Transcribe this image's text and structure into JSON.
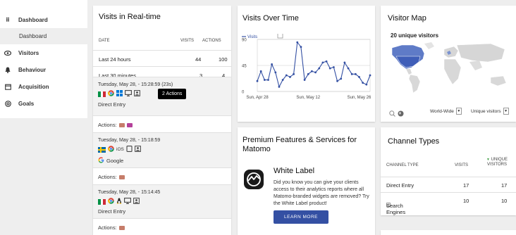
{
  "sidebar": {
    "items": [
      {
        "label": "Dashboard",
        "icon": "grid-icon"
      },
      {
        "label": "Visitors",
        "icon": "eye-icon"
      },
      {
        "label": "Behaviour",
        "icon": "bell-icon"
      },
      {
        "label": "Acquisition",
        "icon": "calendar-icon"
      },
      {
        "label": "Goals",
        "icon": "target-icon"
      }
    ],
    "subitem": "Dashboard"
  },
  "realtime": {
    "title": "Visits in Real-time",
    "columns": {
      "date": "DATE",
      "visits": "VISITS",
      "actions": "ACTIONS"
    },
    "rows": [
      {
        "label": "Last 24 hours",
        "visits": "44",
        "actions": "100"
      },
      {
        "label": "Last 30 minutes",
        "visits": "3",
        "actions": "4"
      }
    ],
    "visits": [
      {
        "time": "Tuesday, May 28, - 15:28:59 (23s)",
        "referrer": "Direct Entry",
        "actions_label": "Actions:",
        "tooltip": "2 Actions"
      },
      {
        "time": "Tuesday, May 28, - 15:18:59",
        "os_label": "iOS",
        "referrer": "Google",
        "actions_label": "Actions:"
      },
      {
        "time": "Tuesday, May 28, - 15:14:45",
        "referrer": "Direct Entry",
        "actions_label": "Actions:"
      }
    ]
  },
  "visits_over_time": {
    "title": "Visits Over Time"
  },
  "chart_data": {
    "type": "line",
    "series": [
      {
        "name": "Visits",
        "values": [
          18,
          35,
          20,
          20,
          47,
          33,
          8,
          20,
          28,
          25,
          30,
          85,
          77,
          20,
          30,
          35,
          33,
          40,
          50,
          52,
          40,
          42,
          18,
          22,
          50,
          40,
          30,
          30,
          25,
          15,
          12,
          28
        ]
      }
    ],
    "x": [
      "Apr 28",
      "Apr 29",
      "Apr 30",
      "May 1",
      "May 2",
      "May 3",
      "May 4",
      "May 5",
      "May 6",
      "May 7",
      "May 8",
      "May 9",
      "May 10",
      "May 11",
      "May 12",
      "May 13",
      "May 14",
      "May 15",
      "May 16",
      "May 17",
      "May 18",
      "May 19",
      "May 20",
      "May 21",
      "May 22",
      "May 23",
      "May 24",
      "May 25",
      "May 26",
      "May 27",
      "May 28",
      "May 29"
    ],
    "x_tick_labels": [
      "Sun, Apr 28",
      "Sun, May 12",
      "Sun, May 26"
    ],
    "y_ticks": [
      0,
      45,
      90
    ],
    "ylim": [
      0,
      90
    ],
    "legend": "top-left",
    "grid": true,
    "color": "#3450a3"
  },
  "visitor_map": {
    "title": "Visitor Map",
    "unique_label": "20 unique visitors",
    "region_select": "World-Wide",
    "metric_select": "Unique visitors"
  },
  "premium": {
    "title": "Premium Features & Services for Matomo",
    "feature_title": "White Label",
    "feature_desc": "Did you know you can give your clients access to their analytics reports where all Matomo-branded widgets are removed? Try the White Label product!",
    "button": "LEARN MORE"
  },
  "channels": {
    "title": "Channel Types",
    "columns": {
      "type": "CHANNEL TYPE",
      "visits": "VISITS",
      "unique1": "UNIQUE",
      "unique2": "VISITORS"
    },
    "rows": [
      {
        "label": "Direct Entry",
        "visits": "17",
        "unique": "17"
      },
      {
        "label": "Search Engines",
        "visits": "10",
        "unique": "10"
      }
    ]
  },
  "colors": {
    "accent": "#3450a3",
    "background": "#eeeeee",
    "sort_arrow": "#43a047"
  }
}
